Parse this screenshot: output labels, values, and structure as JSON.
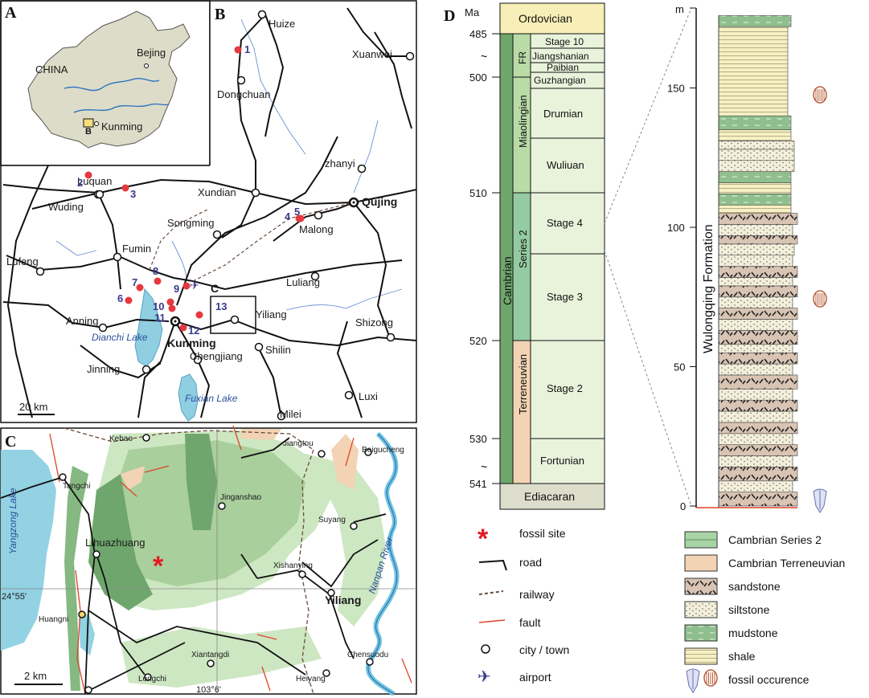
{
  "panels": {
    "a": "A",
    "b": "B",
    "c": "C",
    "d": "D"
  },
  "panel_a": {
    "country": "CHINA",
    "beijing": "Bejing",
    "kunming": "Kunming",
    "box": "B"
  },
  "panel_b": {
    "cities": {
      "huize": "Huize",
      "xuanwei": "Xuanwei",
      "dongchuan": "Dongchuan",
      "luquan": "Luquan",
      "wuding": "Wuding",
      "xundian": "Xundian",
      "zhanyi": "zhanyi",
      "qujing": "Qujing",
      "malong": "Malong",
      "songming": "Songming",
      "fumin": "Fumin",
      "lufeng": "Lufeng",
      "luliang": "Luliang",
      "anning": "Anning",
      "yiliang": "Yiliang",
      "shizong": "Shizong",
      "kunming": "Kunming",
      "shilin": "Shilin",
      "jinning": "Jinning",
      "chengjiang": "Chengjiang",
      "luxi": "Luxi",
      "milei": "Milei"
    },
    "lakes": {
      "dianchi": "Dianchi Lake",
      "fuxian": "Fuxian Lake"
    },
    "sites": [
      "1",
      "2",
      "3",
      "4",
      "5",
      "6",
      "7",
      "8",
      "9",
      "10",
      "11",
      "12",
      "13"
    ],
    "inset_label": "C",
    "scale": "20 km"
  },
  "panel_c": {
    "places": {
      "kebao": "Kebao",
      "jiangtou": "Jiangtou",
      "beigucheng": "Beigucheng",
      "tangchi": "Tangchi",
      "jinganshao": "Jinganshao",
      "suyang": "Suyang",
      "lihuazhuang": "Lihuazhuang",
      "xishanying": "Xishanying",
      "yiliang": "Yiliang",
      "huangni": "Huangni",
      "xiantangdi": "Xiantangdi",
      "chensuodu": "Chensuodu",
      "longchi": "Longchi",
      "heiyang": "Heiyang"
    },
    "lakes": {
      "yangzong": "Yangzong Lake",
      "nanpan": "Nanpan River"
    },
    "lat": "24°55'",
    "lon": "103°6'",
    "scale": "2 km"
  },
  "chart_data": {
    "type": "table",
    "units": "Ma",
    "ages": [
      "485",
      "500",
      "510",
      "520",
      "530",
      "541"
    ],
    "systems": {
      "above": "Ordovician",
      "below": "Ediacaran",
      "main": "Cambrian"
    },
    "series": [
      "FR",
      "Miaolingian",
      "Series 2",
      "Terreneuvian"
    ],
    "stages": [
      "Stage 10",
      "Jiangshanian",
      "Paibian",
      "Guzhangian",
      "Drumian",
      "Wuliuan",
      "Stage 4",
      "Stage 3",
      "Stage 2",
      "Fortunian"
    ],
    "column": {
      "unit_label": "m",
      "ticks": [
        "0",
        "50",
        "100",
        "150"
      ],
      "formation": "Wulongqing Formation"
    },
    "legend": [
      {
        "key": "series2",
        "label": "Cambrian Series 2",
        "color": "#a9d5a6"
      },
      {
        "key": "terreneuvian",
        "label": "Cambrian Terreneuvian",
        "color": "#f2d3b3"
      },
      {
        "key": "sandstone",
        "label": "sandstone",
        "color": "#d9c4b4"
      },
      {
        "key": "siltstone",
        "label": "siltstone",
        "color": "#f0ecd6"
      },
      {
        "key": "mudstone",
        "label": "mudstone",
        "color": "#8fbf8e"
      },
      {
        "key": "shale",
        "label": "shale",
        "color": "#f4efc0"
      },
      {
        "key": "fossil",
        "label": "fossil occurence",
        "color": "#b85c3a"
      }
    ]
  },
  "map_legend": [
    {
      "key": "fossil_site",
      "label": "fossil site"
    },
    {
      "key": "road",
      "label": "road"
    },
    {
      "key": "railway",
      "label": "railway"
    },
    {
      "key": "fault",
      "label": "fault"
    },
    {
      "key": "city",
      "label": "city / town"
    },
    {
      "key": "airport",
      "label": "airport"
    }
  ]
}
